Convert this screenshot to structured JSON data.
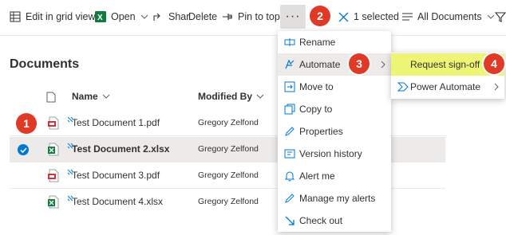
{
  "toolbar": {
    "edit_grid": "Edit in grid view",
    "open": "Open",
    "share": "Shar",
    "delete": "Delete",
    "pin": "Pin to top",
    "more": "···",
    "selected": "1 selected",
    "view": "All Documents"
  },
  "library": {
    "title": "Documents",
    "col_name": "Name",
    "col_modified": "Modified By",
    "rows": [
      {
        "name": "Test Document 1.pdf",
        "modified_by": "Gregory Zelfond",
        "type": "pdf",
        "selected": false
      },
      {
        "name": "Test Document 2.xlsx",
        "modified_by": "Gregory Zelfond",
        "type": "xlsx",
        "selected": true
      },
      {
        "name": "Test Document 3.pdf",
        "modified_by": "Gregory Zelfond",
        "type": "pdf",
        "selected": false
      },
      {
        "name": "Test Document 4.xlsx",
        "modified_by": "Gregory Zelfond",
        "type": "xlsx",
        "selected": false
      }
    ]
  },
  "context_menu": {
    "items": [
      {
        "label": "Rename",
        "icon": "rename-icon"
      },
      {
        "label": "Automate",
        "icon": "automate-icon",
        "has_submenu": true,
        "highlighted": true
      },
      {
        "label": "Move to",
        "icon": "move-icon"
      },
      {
        "label": "Copy to",
        "icon": "copy-icon"
      },
      {
        "label": "Properties",
        "icon": "pencil-icon"
      },
      {
        "label": "Version history",
        "icon": "history-icon"
      },
      {
        "label": "Alert me",
        "icon": "bell-icon"
      },
      {
        "label": "Manage my alerts",
        "icon": "pencil-icon"
      },
      {
        "label": "Check out",
        "icon": "checkout-icon"
      }
    ]
  },
  "submenu": {
    "items": [
      {
        "label": "Request sign-off",
        "highlighted": true
      },
      {
        "label": "Power Automate",
        "has_submenu": true
      }
    ]
  },
  "callouts": [
    "1",
    "2",
    "3",
    "4"
  ],
  "colors": {
    "callout": "#e03a26",
    "accent": "#0078d4",
    "pdf": "#d13438",
    "excel": "#107c41",
    "highlight": "#eef575",
    "hover": "#edebe9"
  }
}
